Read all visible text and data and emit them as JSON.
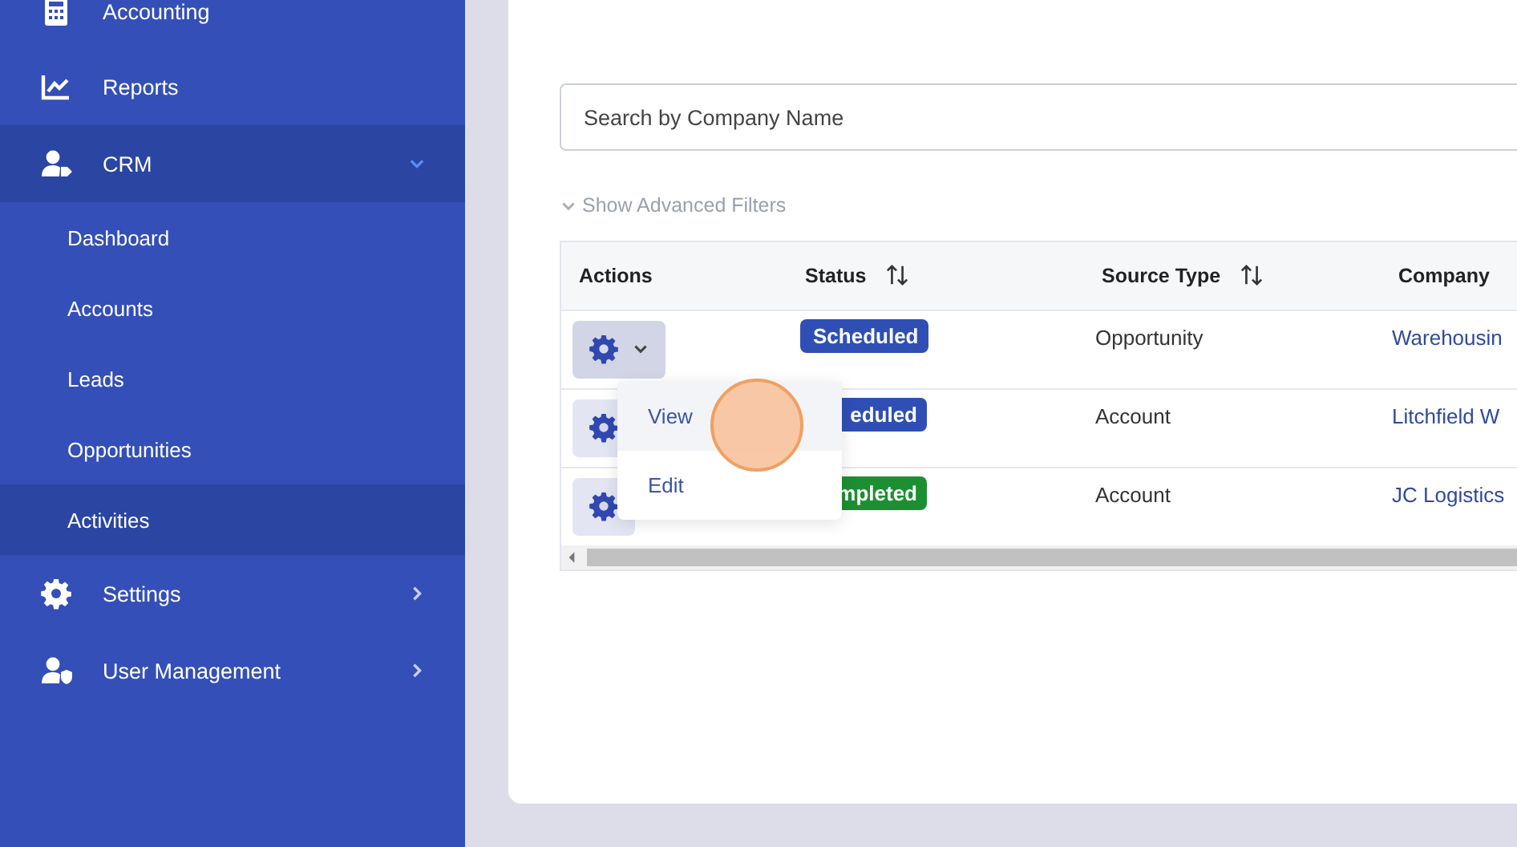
{
  "sidebar": {
    "items": [
      {
        "label": "Accounting",
        "selected": false,
        "expandable": false
      },
      {
        "label": "Reports",
        "selected": false,
        "expandable": false
      },
      {
        "label": "CRM",
        "selected": true,
        "expandable": true,
        "expanded": true,
        "children": [
          {
            "label": "Dashboard",
            "selected": false
          },
          {
            "label": "Accounts",
            "selected": false
          },
          {
            "label": "Leads",
            "selected": false
          },
          {
            "label": "Opportunities",
            "selected": false
          },
          {
            "label": "Activities",
            "selected": true
          }
        ]
      },
      {
        "label": "Settings",
        "selected": false,
        "expandable": true,
        "expanded": false
      },
      {
        "label": "User Management",
        "selected": false,
        "expandable": true,
        "expanded": false
      }
    ]
  },
  "search": {
    "placeholder": "Search by Company Name"
  },
  "filters_toggle": {
    "label": "Show Advanced Filters"
  },
  "table": {
    "columns": [
      {
        "label": "Actions",
        "sortable": false
      },
      {
        "label": "Status",
        "sortable": true
      },
      {
        "label": "Source Type",
        "sortable": true
      },
      {
        "label": "Company",
        "sortable": false
      }
    ],
    "rows": [
      {
        "menu_open": true,
        "status": "Scheduled",
        "color": "#2f4fb5",
        "source_type": "Opportunity",
        "company": "Warehousin"
      },
      {
        "menu_open": false,
        "status": "eduled",
        "color": "#2f4fb5",
        "source_type": "Account",
        "company": "Litchfield W"
      },
      {
        "menu_open": false,
        "status": "mpleted",
        "color": "#1d8f33",
        "source_type": "Account",
        "company": "JC Logistics"
      }
    ]
  },
  "action_menu": {
    "items": [
      {
        "label": "View",
        "selected": true
      },
      {
        "label": "Edit",
        "selected": false
      }
    ]
  }
}
